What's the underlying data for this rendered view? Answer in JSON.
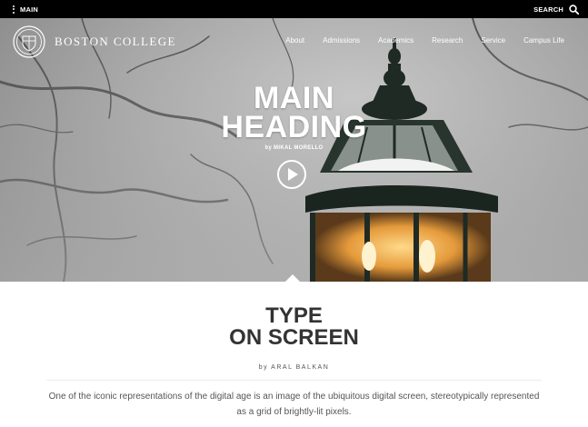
{
  "topbar": {
    "menu_label": "MAIN",
    "search_label": "SEARCH"
  },
  "brand": {
    "name": "BOSTON COLLEGE"
  },
  "nav": {
    "items": [
      "About",
      "Admissions",
      "Academics",
      "Research",
      "Service",
      "Campus Life"
    ]
  },
  "hero": {
    "title": "MAIN\nHEADING",
    "byline": "by MIKAL MORELLO"
  },
  "article": {
    "title": "TYPE\nON SCREEN",
    "byline": "by ARAL BALKAN",
    "body": "One of the iconic representations of the digital age is an image of the ubiquitous digital screen, stereotypically represented as a grid of brightly-lit pixels."
  },
  "colors": {
    "topbar": "#000000",
    "text_dark": "#333333",
    "text_body": "#555555",
    "lamp_glow": "#f3b45a"
  },
  "icons": {
    "menu": "vertical-dots-icon",
    "search": "search-icon",
    "play": "play-icon"
  }
}
